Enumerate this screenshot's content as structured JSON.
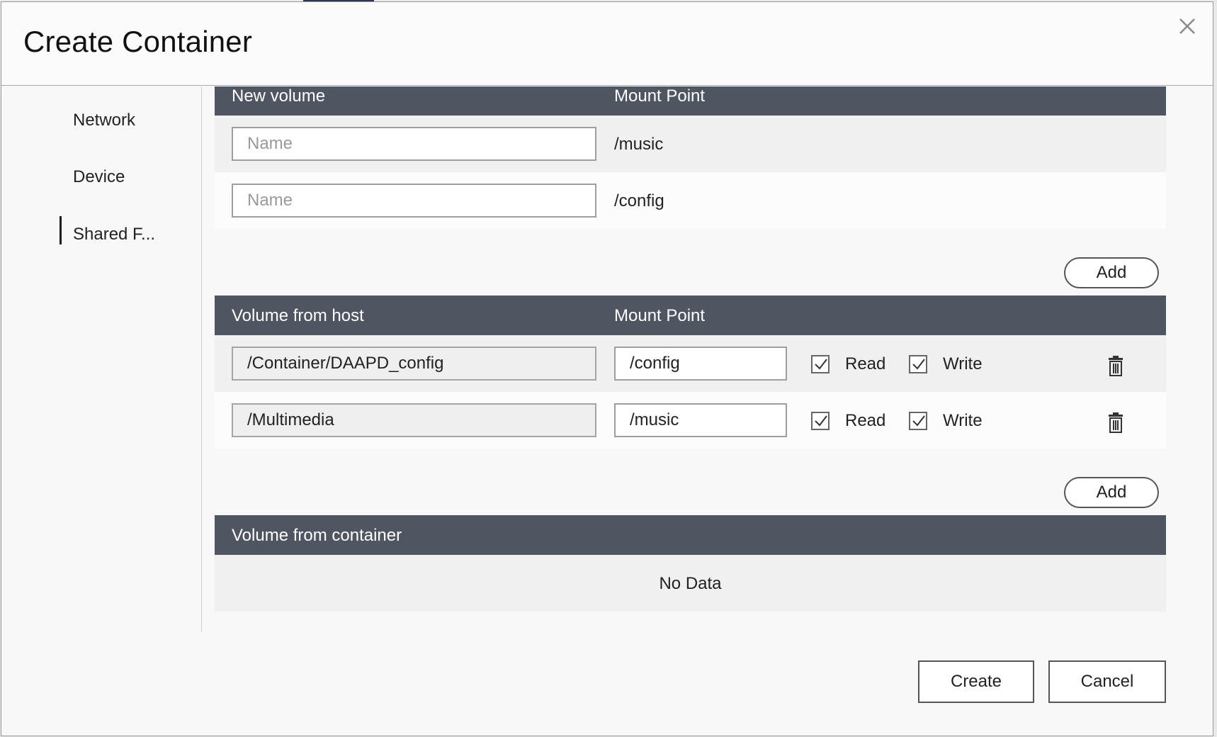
{
  "dialog": {
    "title": "Create Container"
  },
  "sidebar": {
    "items": [
      {
        "label": "Network"
      },
      {
        "label": "Device"
      },
      {
        "label": "Shared F..."
      }
    ]
  },
  "new_volume": {
    "header": {
      "col1": "New volume",
      "col2": "Mount Point"
    },
    "rows": [
      {
        "name_placeholder": "Name",
        "name_value": "",
        "mount_point": "/music"
      },
      {
        "name_placeholder": "Name",
        "name_value": "",
        "mount_point": "/config"
      }
    ],
    "add_label": "Add"
  },
  "volume_from_host": {
    "header": {
      "col1": "Volume from host",
      "col2": "Mount Point"
    },
    "rows": [
      {
        "host_path": "/Container/DAAPD_config",
        "mount_point": "/config",
        "read_label": "Read",
        "read_checked": true,
        "write_label": "Write",
        "write_checked": true
      },
      {
        "host_path": "/Multimedia",
        "mount_point": "/music",
        "read_label": "Read",
        "read_checked": true,
        "write_label": "Write",
        "write_checked": true
      }
    ],
    "add_label": "Add"
  },
  "volume_from_container": {
    "header": {
      "col1": "Volume from container"
    },
    "empty_text": "No Data"
  },
  "footer": {
    "create_label": "Create",
    "cancel_label": "Cancel"
  },
  "colors": {
    "table_header_bg": "#4f5561",
    "accent": "#2d3a55"
  }
}
